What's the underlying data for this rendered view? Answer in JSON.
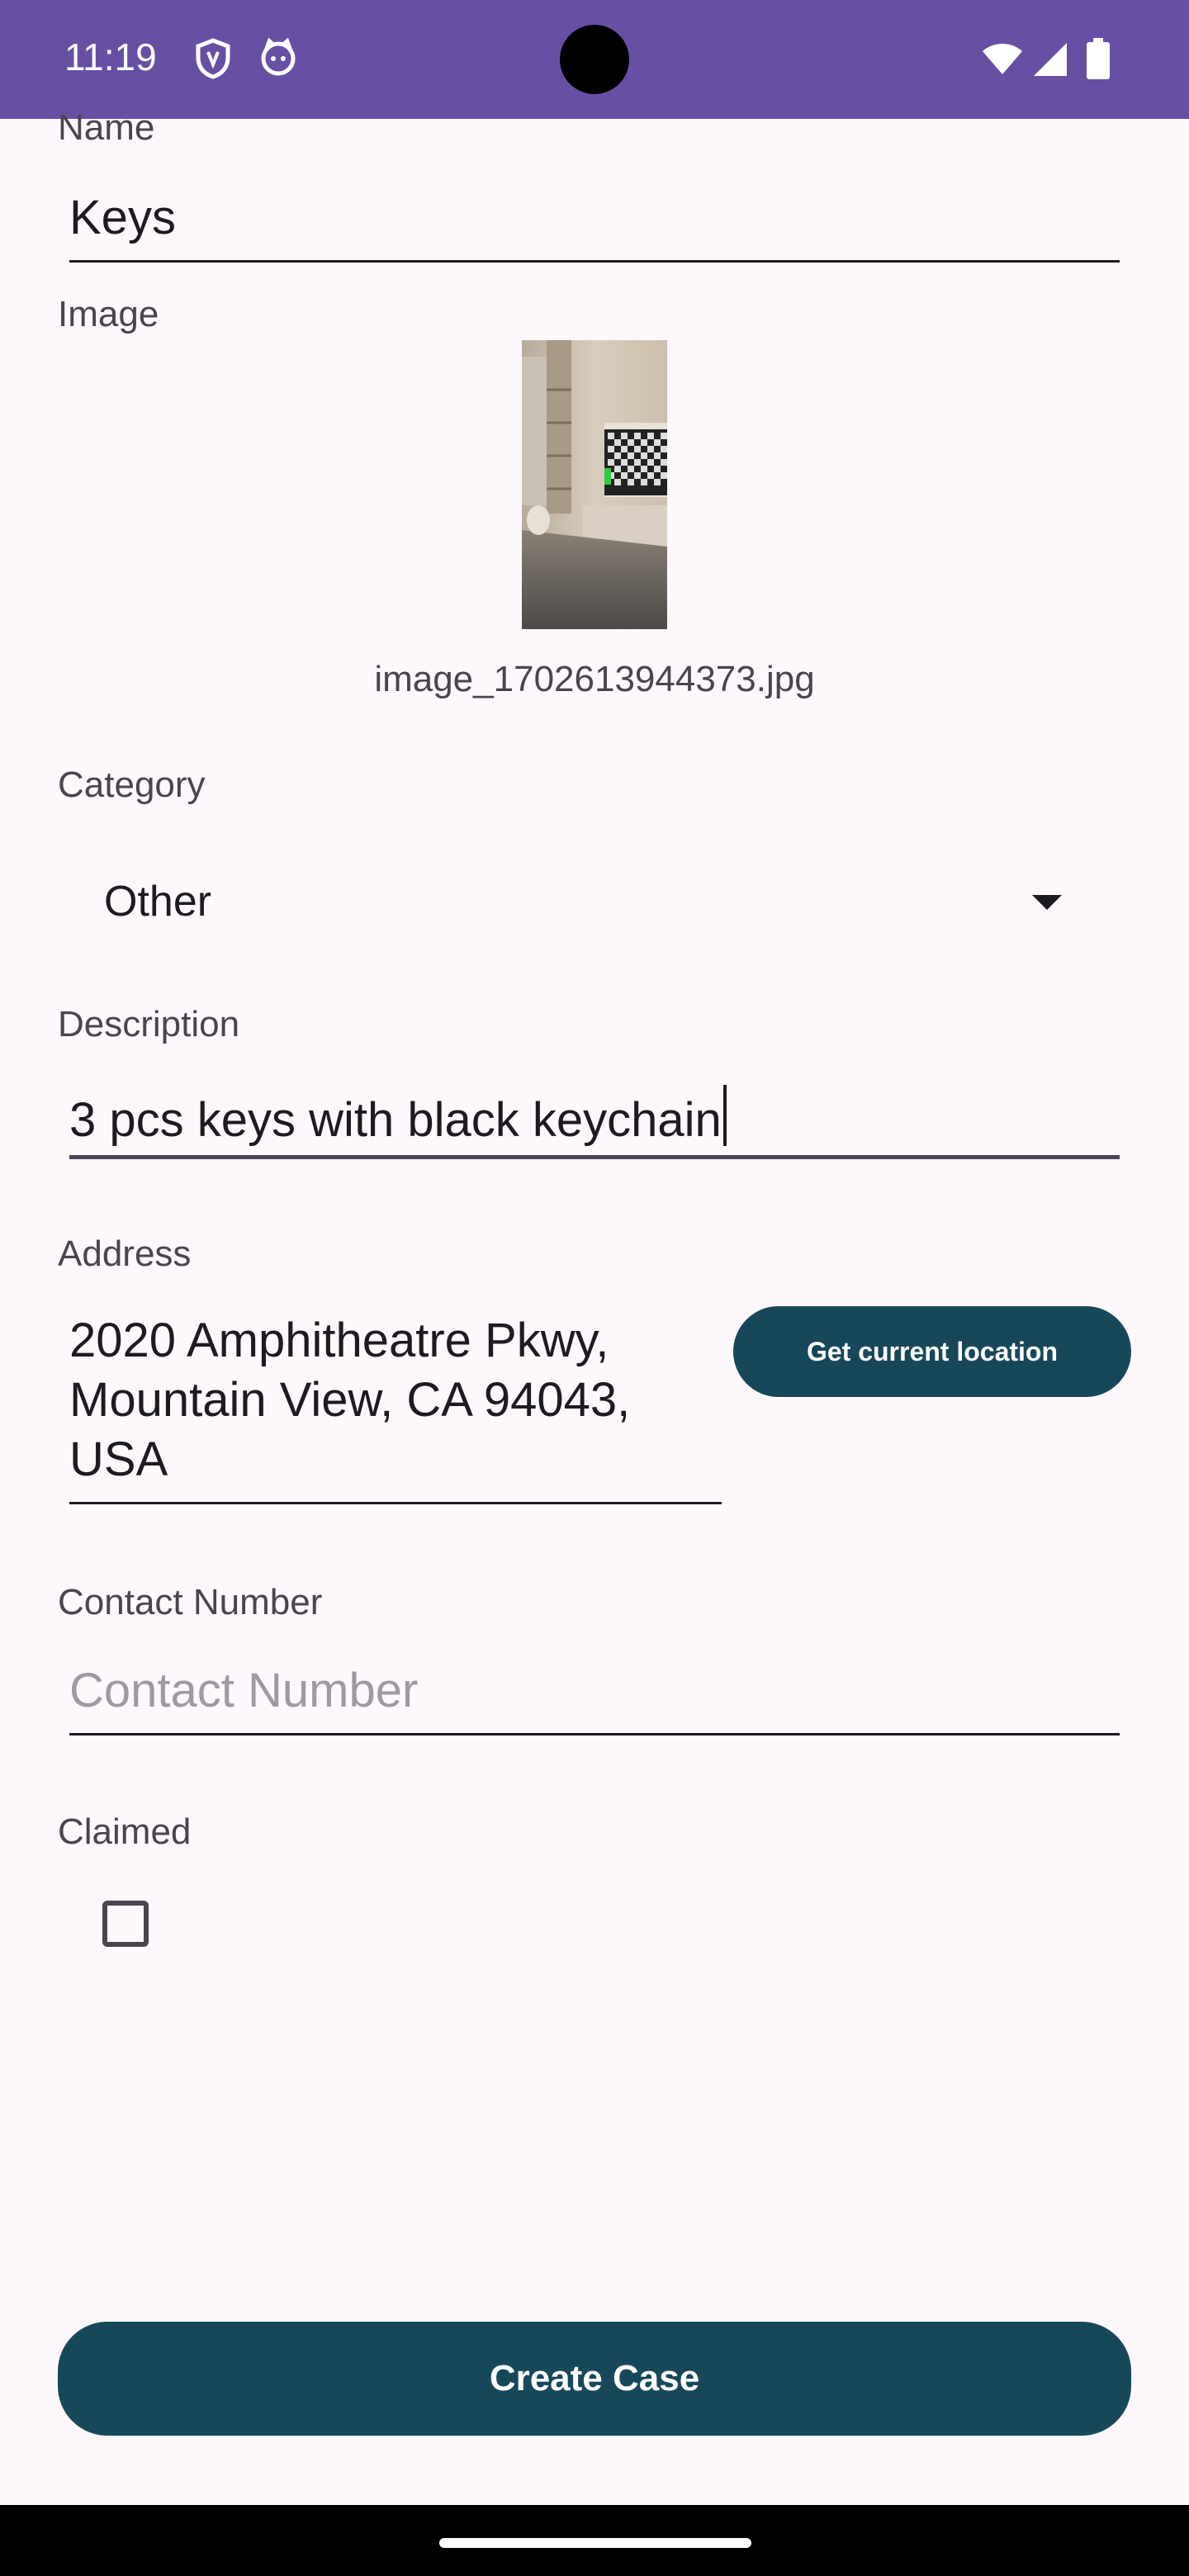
{
  "status_bar": {
    "time": "11:19"
  },
  "form": {
    "name": {
      "label": "Name",
      "value": "Keys"
    },
    "image": {
      "label": "Image",
      "file_name": "image_1702613944373.jpg"
    },
    "category": {
      "label": "Category",
      "selected": "Other"
    },
    "description": {
      "label": "Description",
      "value": "3 pcs keys with black keychain"
    },
    "address": {
      "label": "Address",
      "lines": [
        "2020 Amphitheatre Pkwy,",
        "Mountain View, CA 94043,",
        "USA"
      ],
      "location_button": "Get current location"
    },
    "contact": {
      "label": "Contact Number",
      "placeholder": "Contact Number",
      "value": ""
    },
    "claimed": {
      "label": "Claimed",
      "checked": false
    },
    "submit_label": "Create Case"
  },
  "colors": {
    "status_bar": "#6750a4",
    "primary_button": "#17485a",
    "background": "#fdf8fc"
  }
}
